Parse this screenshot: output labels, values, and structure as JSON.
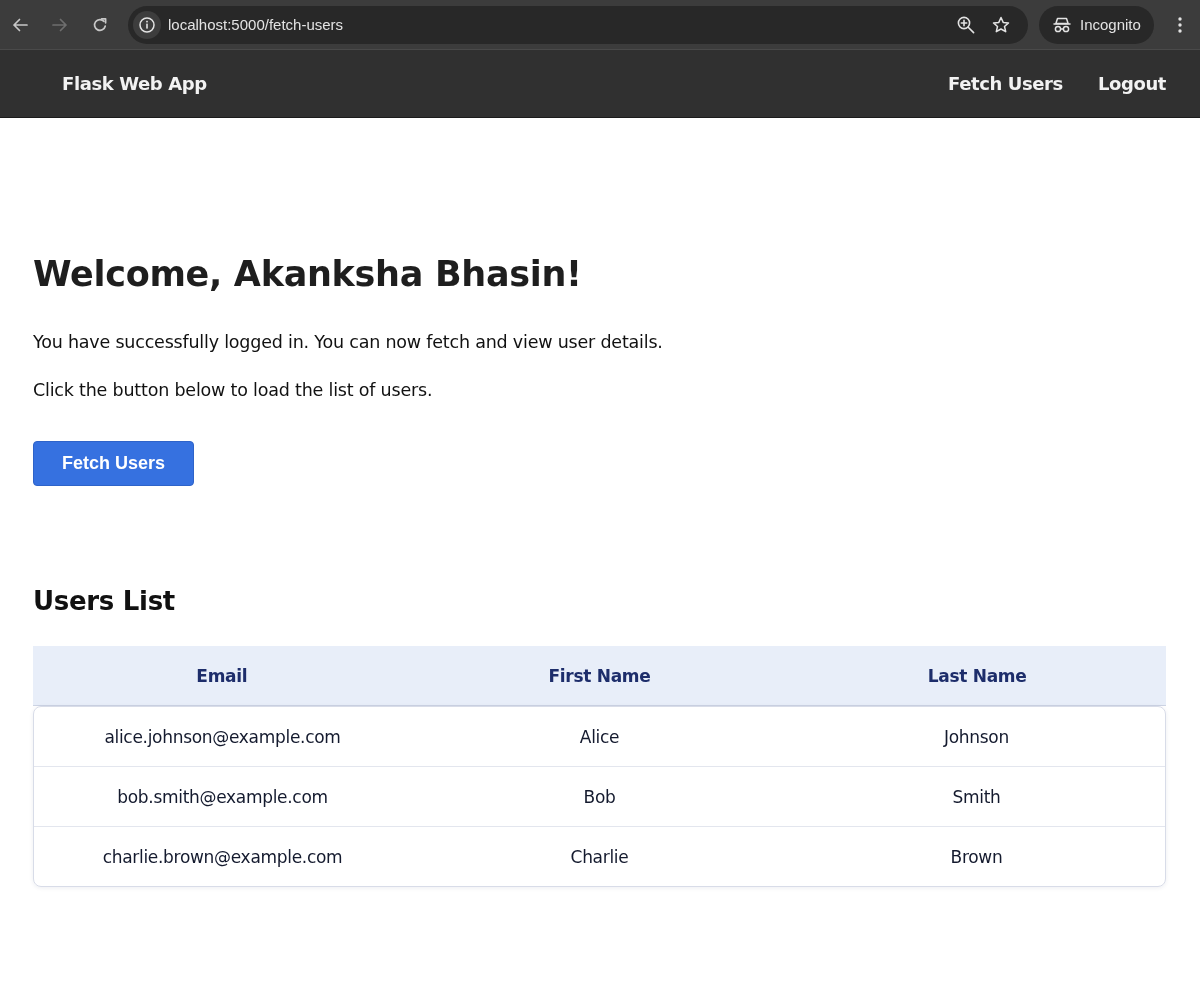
{
  "browser": {
    "nav_buttons": [
      {
        "kind": "back",
        "disabled": false
      },
      {
        "kind": "forward",
        "disabled": true
      },
      {
        "kind": "reload",
        "disabled": false
      }
    ],
    "url": "localhost:5000/fetch-users",
    "profile": "Incognito"
  },
  "navbar": {
    "brand": "Flask Web App",
    "links": [
      "Fetch Users",
      "Logout"
    ]
  },
  "welcome": {
    "title": "Welcome, Akanksha Bhasin!",
    "paragraphs": [
      "You have successfully logged in. You can now fetch and view user details.",
      "Click the button below to load the list of users."
    ],
    "button": "Fetch Users"
  },
  "users": {
    "title": "Users List",
    "table": {
      "columns": [
        "Email",
        "First Name",
        "Last Name"
      ],
      "rows": [
        [
          "alice.johnson@example.com",
          "Alice",
          "Johnson"
        ],
        [
          "bob.smith@example.com",
          "Bob",
          "Smith"
        ],
        [
          "charlie.brown@example.com",
          "Charlie",
          "Brown"
        ]
      ]
    }
  }
}
